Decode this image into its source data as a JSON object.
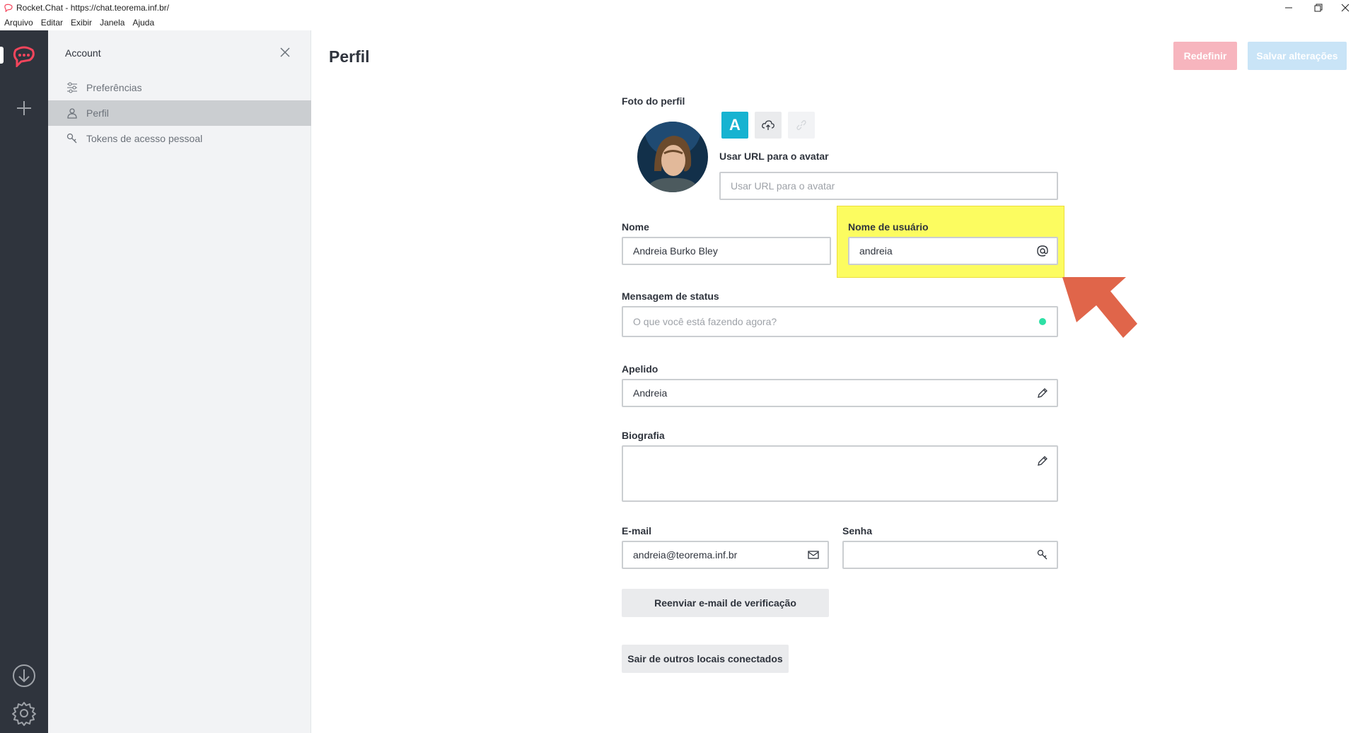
{
  "window": {
    "title": "Rocket.Chat - https://chat.teorema.inf.br/"
  },
  "menubar": [
    "Arquivo",
    "Editar",
    "Exibir",
    "Janela",
    "Ajuda"
  ],
  "sidebar": {
    "title": "Account",
    "items": [
      {
        "label": "Preferências",
        "icon": "sliders-icon",
        "active": false
      },
      {
        "label": "Perfil",
        "icon": "user-icon",
        "active": true
      },
      {
        "label": "Tokens de acesso pessoal",
        "icon": "key-icon",
        "active": false
      }
    ]
  },
  "main": {
    "title": "Perfil",
    "reset_label": "Redefinir",
    "save_label": "Salvar alterações",
    "photo_label": "Foto do perfil",
    "avatar_letter": "A",
    "avatar_url_label": "Usar URL para o avatar",
    "avatar_url_placeholder": "Usar URL para o avatar",
    "name_label": "Nome",
    "name_value": "Andreia Burko Bley",
    "username_label": "Nome de usuário",
    "username_value": "andreia",
    "status_label": "Mensagem de status",
    "status_placeholder": "O que você está fazendo agora?",
    "nickname_label": "Apelido",
    "nickname_value": "Andreia",
    "bio_label": "Biografia",
    "bio_value": "",
    "email_label": "E-mail",
    "email_value": "andreia@teorema.inf.br",
    "password_label": "Senha",
    "password_value": "",
    "resend_label": "Reenviar e-mail de verificação",
    "logout_label": "Sair de outros locais conectados"
  },
  "colors": {
    "rail": "#2f343d",
    "brand": "#f5455c",
    "accent": "#1d74f5",
    "highlight": "#fcfc60",
    "arrow": "#e0654a",
    "status_online": "#2de0a5"
  }
}
